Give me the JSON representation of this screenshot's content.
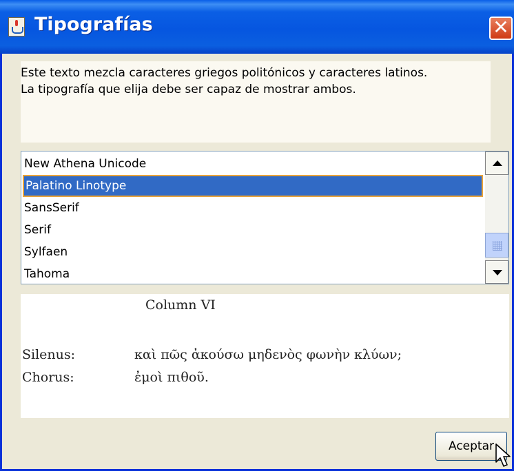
{
  "window": {
    "title": "Tipografías",
    "close_label": "✕"
  },
  "info": {
    "line1": "Este texto mezcla caracteres griegos politónicos y caracteres latinos.",
    "line2": "La tipografía que elija debe ser capaz de mostrar ambos."
  },
  "font_list": {
    "items": [
      "New Athena Unicode",
      "Palatino Linotype",
      "SansSerif",
      "Serif",
      "Sylfaen",
      "Tahoma"
    ],
    "selected": "Palatino Linotype"
  },
  "preview": {
    "heading": "Column VI",
    "rows": [
      {
        "speaker": "Silenus:",
        "line": "καὶ πῶς ἀκούσω μηδενὸς φωνὴν κλύων;"
      },
      {
        "speaker": "Chorus:",
        "line": "ἐμοὶ πιθοῦ."
      }
    ]
  },
  "buttons": {
    "accept": "Aceptar"
  },
  "colors": {
    "titlebar": "#0a5fe8",
    "selection": "#316ac5",
    "selection_border": "#e9a33a",
    "window_bg": "#ece9d8"
  },
  "icons": {
    "app": "java-cup-icon",
    "close": "close-icon",
    "scroll_up": "arrow-up-icon",
    "scroll_down": "arrow-down-icon",
    "cursor": "mouse-pointer-icon"
  }
}
